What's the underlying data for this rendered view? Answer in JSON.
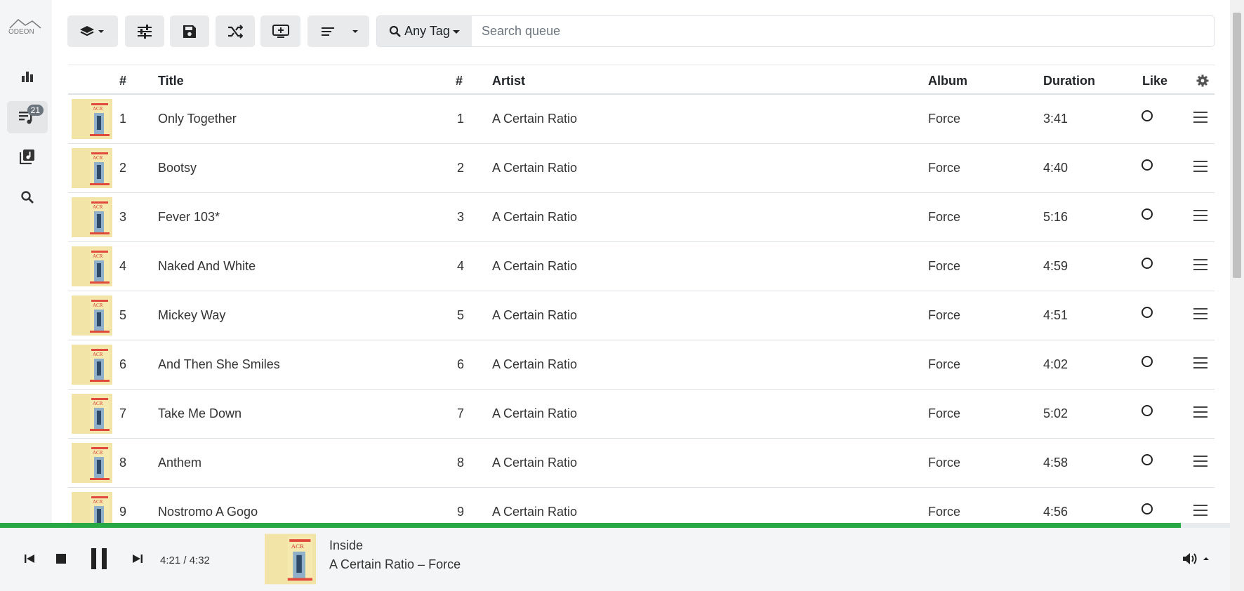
{
  "sidebar": {
    "logo_text": "ODEON",
    "items": [
      {
        "name": "stats",
        "icon": "bar-chart-icon"
      },
      {
        "name": "queue",
        "icon": "playlist-icon",
        "badge": "21",
        "active": true
      },
      {
        "name": "library",
        "icon": "music-library-icon"
      },
      {
        "name": "search",
        "icon": "search-icon"
      }
    ]
  },
  "toolbar": {
    "buttons": [
      "layers-dropdown",
      "mixer",
      "save",
      "shuffle",
      "add-to-screen",
      "sort-dropdown"
    ],
    "tag_select": "Any Tag",
    "search_placeholder": "Search queue"
  },
  "table": {
    "headers": {
      "pos": "#",
      "title": "Title",
      "track": "#",
      "artist": "Artist",
      "album": "Album",
      "duration": "Duration",
      "like": "Like"
    },
    "rows": [
      {
        "pos": "1",
        "title": "Only Together",
        "track": "1",
        "artist": "A Certain Ratio",
        "album": "Force",
        "duration": "3:41"
      },
      {
        "pos": "2",
        "title": "Bootsy",
        "track": "2",
        "artist": "A Certain Ratio",
        "album": "Force",
        "duration": "4:40"
      },
      {
        "pos": "3",
        "title": "Fever 103*",
        "track": "3",
        "artist": "A Certain Ratio",
        "album": "Force",
        "duration": "5:16"
      },
      {
        "pos": "4",
        "title": "Naked And White",
        "track": "4",
        "artist": "A Certain Ratio",
        "album": "Force",
        "duration": "4:59"
      },
      {
        "pos": "5",
        "title": "Mickey Way",
        "track": "5",
        "artist": "A Certain Ratio",
        "album": "Force",
        "duration": "4:51"
      },
      {
        "pos": "6",
        "title": "And Then She Smiles",
        "track": "6",
        "artist": "A Certain Ratio",
        "album": "Force",
        "duration": "4:02"
      },
      {
        "pos": "7",
        "title": "Take Me Down",
        "track": "7",
        "artist": "A Certain Ratio",
        "album": "Force",
        "duration": "5:02"
      },
      {
        "pos": "8",
        "title": "Anthem",
        "track": "8",
        "artist": "A Certain Ratio",
        "album": "Force",
        "duration": "4:58"
      },
      {
        "pos": "9",
        "title": "Nostromo A Gogo",
        "track": "9",
        "artist": "A Certain Ratio",
        "album": "Force",
        "duration": "4:56"
      }
    ]
  },
  "player": {
    "time": "4:21 / 4:32",
    "progress_fraction": 0.96,
    "now_playing_title": "Inside",
    "now_playing_subtitle": "A Certain Ratio – Force"
  },
  "colors": {
    "accent": "#28a745",
    "sidebar_bg": "#f4f5f6",
    "button_bg": "#e9eaeb"
  }
}
